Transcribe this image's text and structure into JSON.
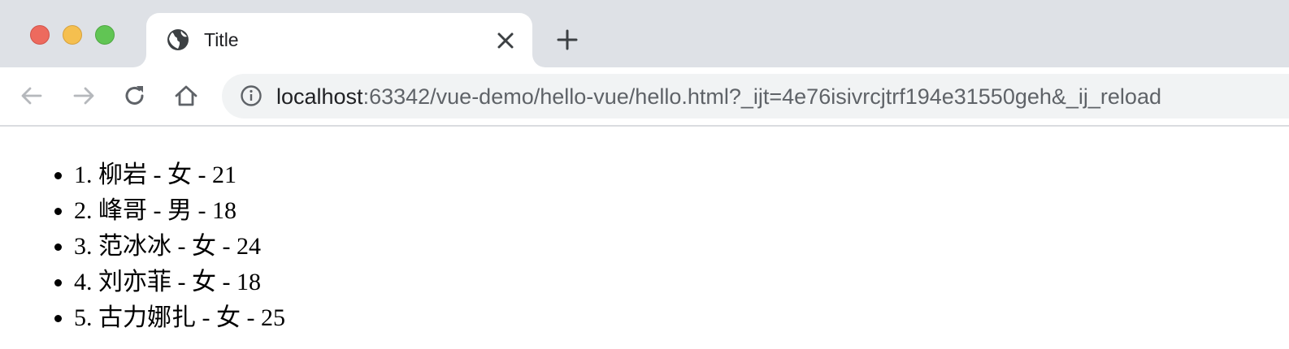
{
  "window": {
    "tab_title": "Title"
  },
  "address_bar": {
    "host": "localhost",
    "path": ":63342/vue-demo/hello-vue/hello.html?_ijt=4e76isivrcjtrf194e31550geh&_ij_reload"
  },
  "icons": {
    "favicon": "globe-icon",
    "tab_close": "close-icon",
    "new_tab": "plus-icon",
    "back": "arrow-left-icon",
    "forward": "arrow-right-icon",
    "reload": "reload-icon",
    "home": "home-icon",
    "site_info": "info-icon"
  },
  "colors": {
    "tabstrip_bg": "#dee1e6",
    "omnibox_bg": "#f1f3f4",
    "traffic_close": "#ed6a5e",
    "traffic_minimize": "#f5bf4f",
    "traffic_zoom": "#61c554"
  },
  "page": {
    "items": [
      "1. 柳岩 - 女 - 21",
      "2. 峰哥 - 男 - 18",
      "3. 范冰冰 - 女 - 24",
      "4. 刘亦菲 - 女 - 18",
      "5. 古力娜扎 - 女 - 25"
    ]
  }
}
